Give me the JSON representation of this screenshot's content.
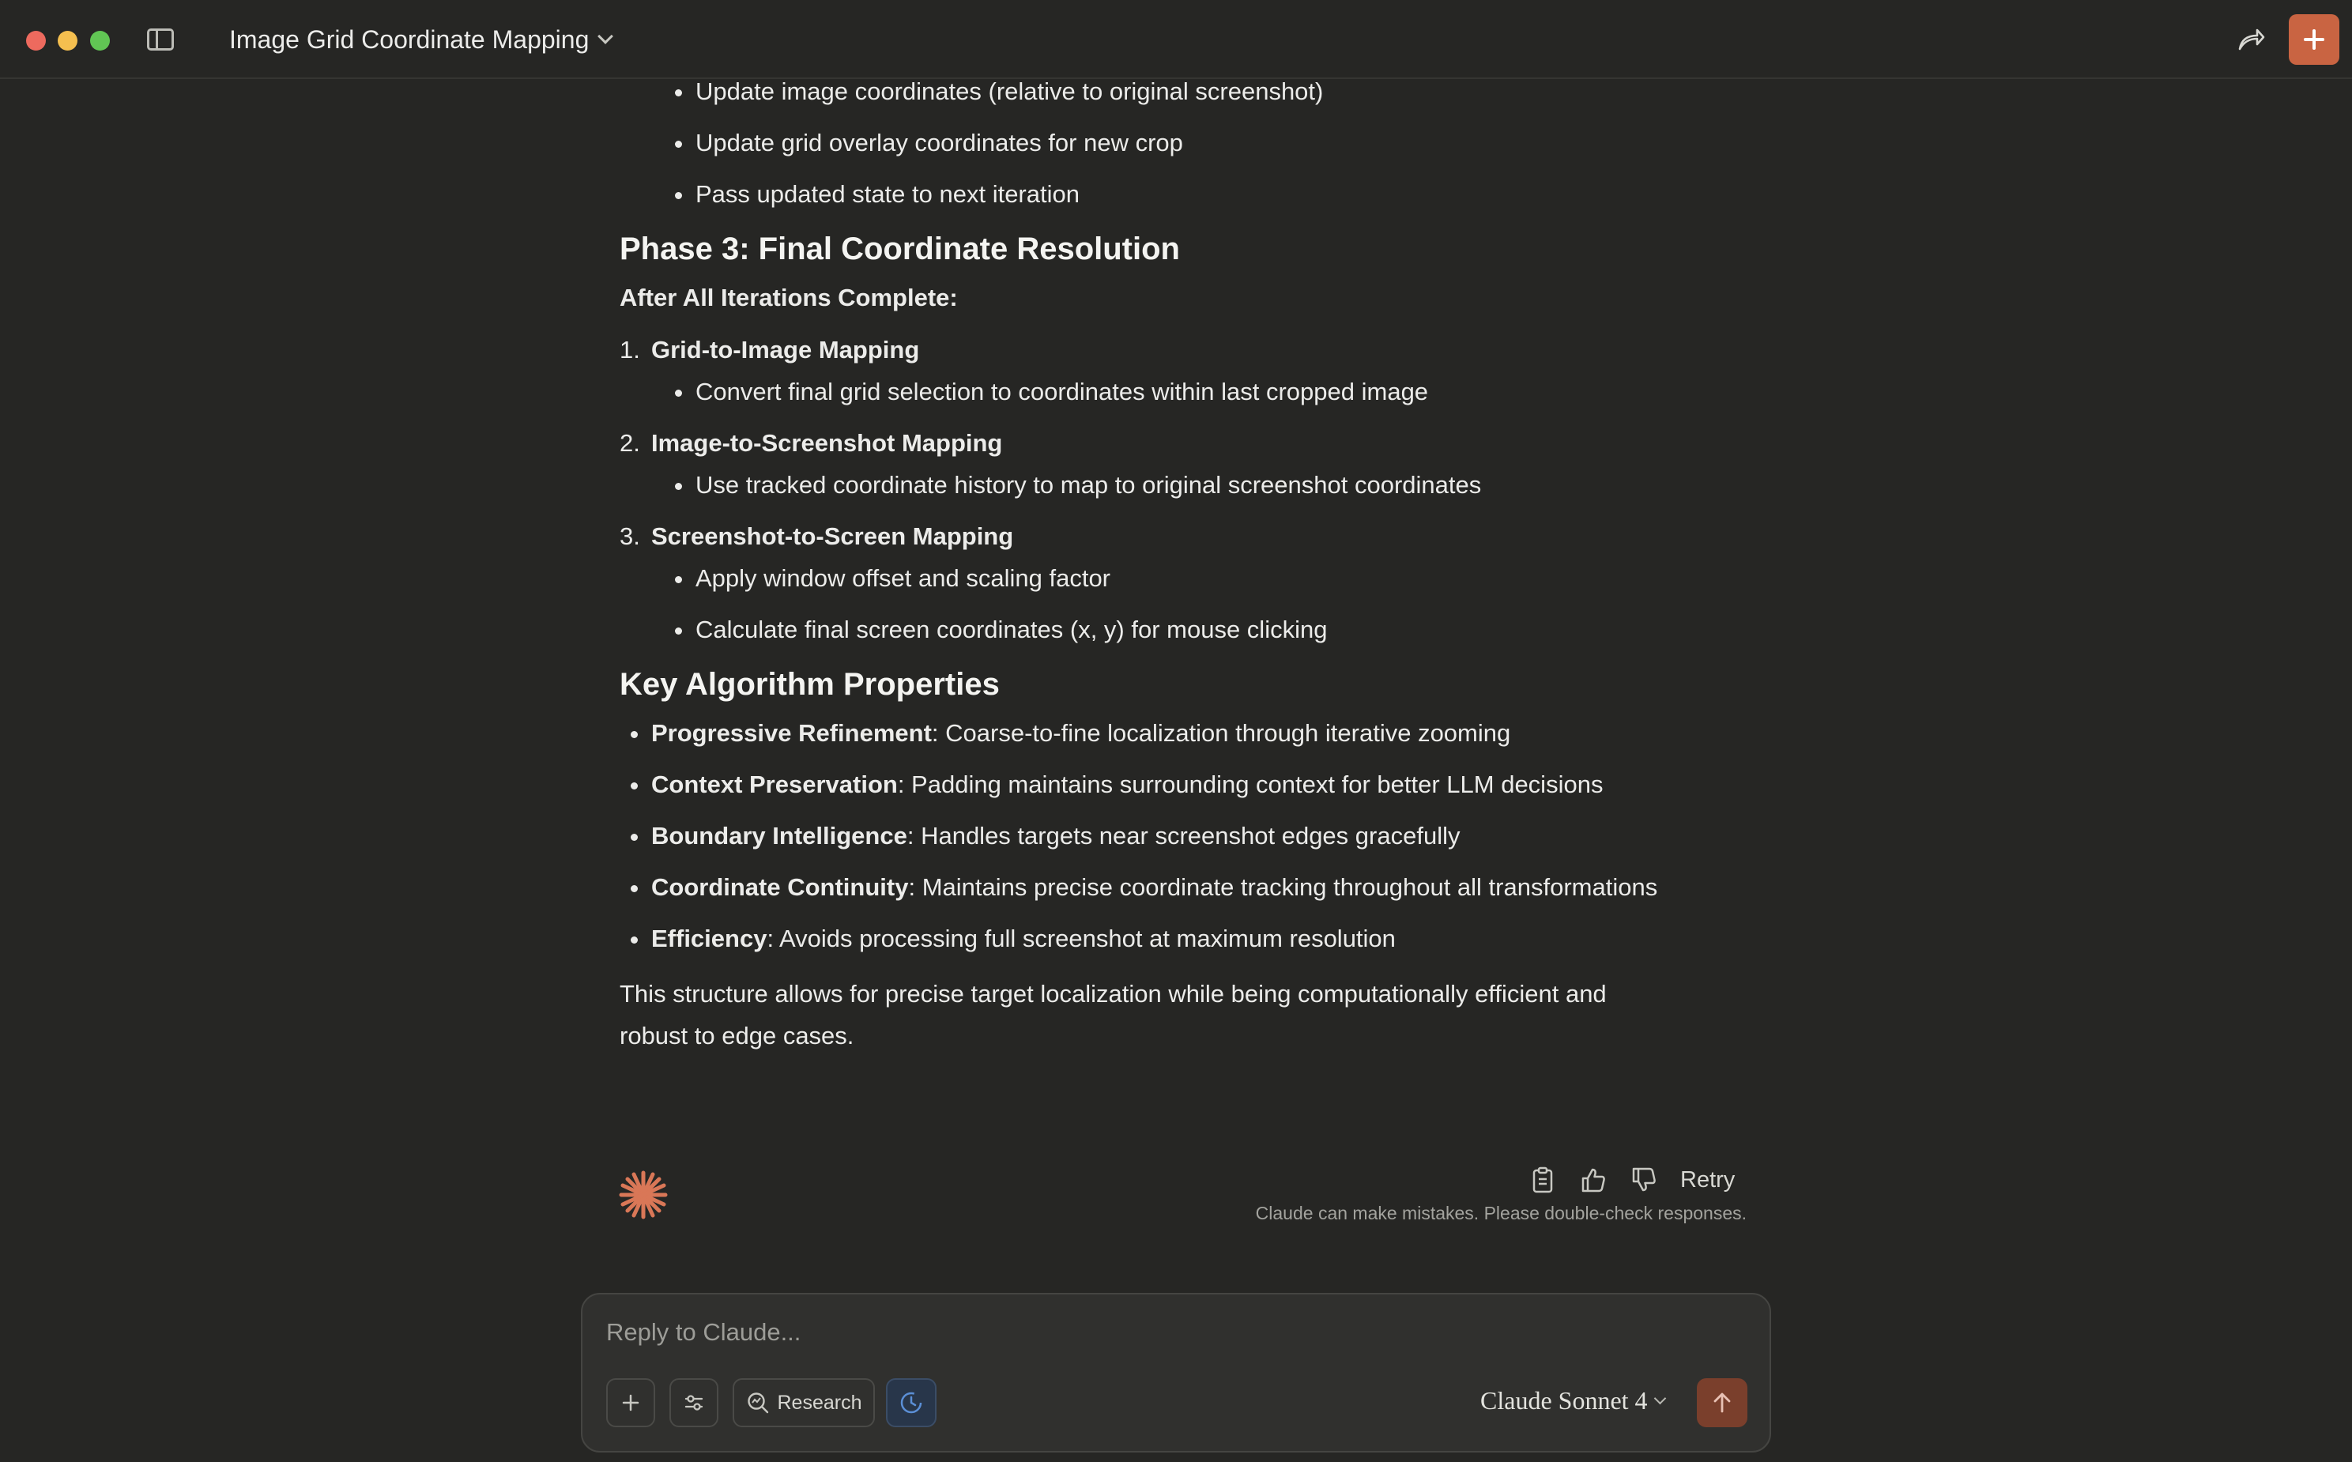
{
  "window": {
    "title": "Image Grid Coordinate Mapping"
  },
  "message": {
    "top_bullets": [
      "Update image coordinates (relative to original screenshot)",
      "Update grid overlay coordinates for new crop",
      "Pass updated state to next iteration"
    ],
    "phase3": {
      "heading": "Phase 3: Final Coordinate Resolution",
      "subheading": "After All Iterations Complete:",
      "steps": [
        {
          "number": "1.",
          "title": "Grid-to-Image Mapping",
          "bullets": [
            "Convert final grid selection to coordinates within last cropped image"
          ]
        },
        {
          "number": "2.",
          "title": "Image-to-Screenshot Mapping",
          "bullets": [
            "Use tracked coordinate history to map to original screenshot coordinates"
          ]
        },
        {
          "number": "3.",
          "title": "Screenshot-to-Screen Mapping",
          "bullets": [
            "Apply window offset and scaling factor",
            "Calculate final screen coordinates (x, y) for mouse clicking"
          ]
        }
      ]
    },
    "properties": {
      "heading": "Key Algorithm Properties",
      "items": [
        {
          "term": "Progressive Refinement",
          "desc": ": Coarse-to-fine localization through iterative zooming"
        },
        {
          "term": "Context Preservation",
          "desc": ": Padding maintains surrounding context for better LLM decisions"
        },
        {
          "term": "Boundary Intelligence",
          "desc": ": Handles targets near screenshot edges gracefully"
        },
        {
          "term": "Coordinate Continuity",
          "desc": ": Maintains precise coordinate tracking throughout all transformations"
        },
        {
          "term": "Efficiency",
          "desc": ": Avoids processing full screenshot at maximum resolution"
        }
      ]
    },
    "conclusion": "This structure allows for precise target localization while being computationally efficient and robust to edge cases."
  },
  "actions": {
    "retry_label": "Retry",
    "icons": [
      "copy-icon",
      "thumbs-up-icon",
      "thumbs-down-icon"
    ]
  },
  "disclaimer": "Claude can make mistakes. Please double-check responses.",
  "composer": {
    "placeholder": "Reply to Claude...",
    "research_label": "Research",
    "model": "Claude Sonnet 4"
  },
  "colors": {
    "background": "#262624",
    "accent": "#c96442",
    "text": "#ececea",
    "muted": "#a3a39e"
  }
}
